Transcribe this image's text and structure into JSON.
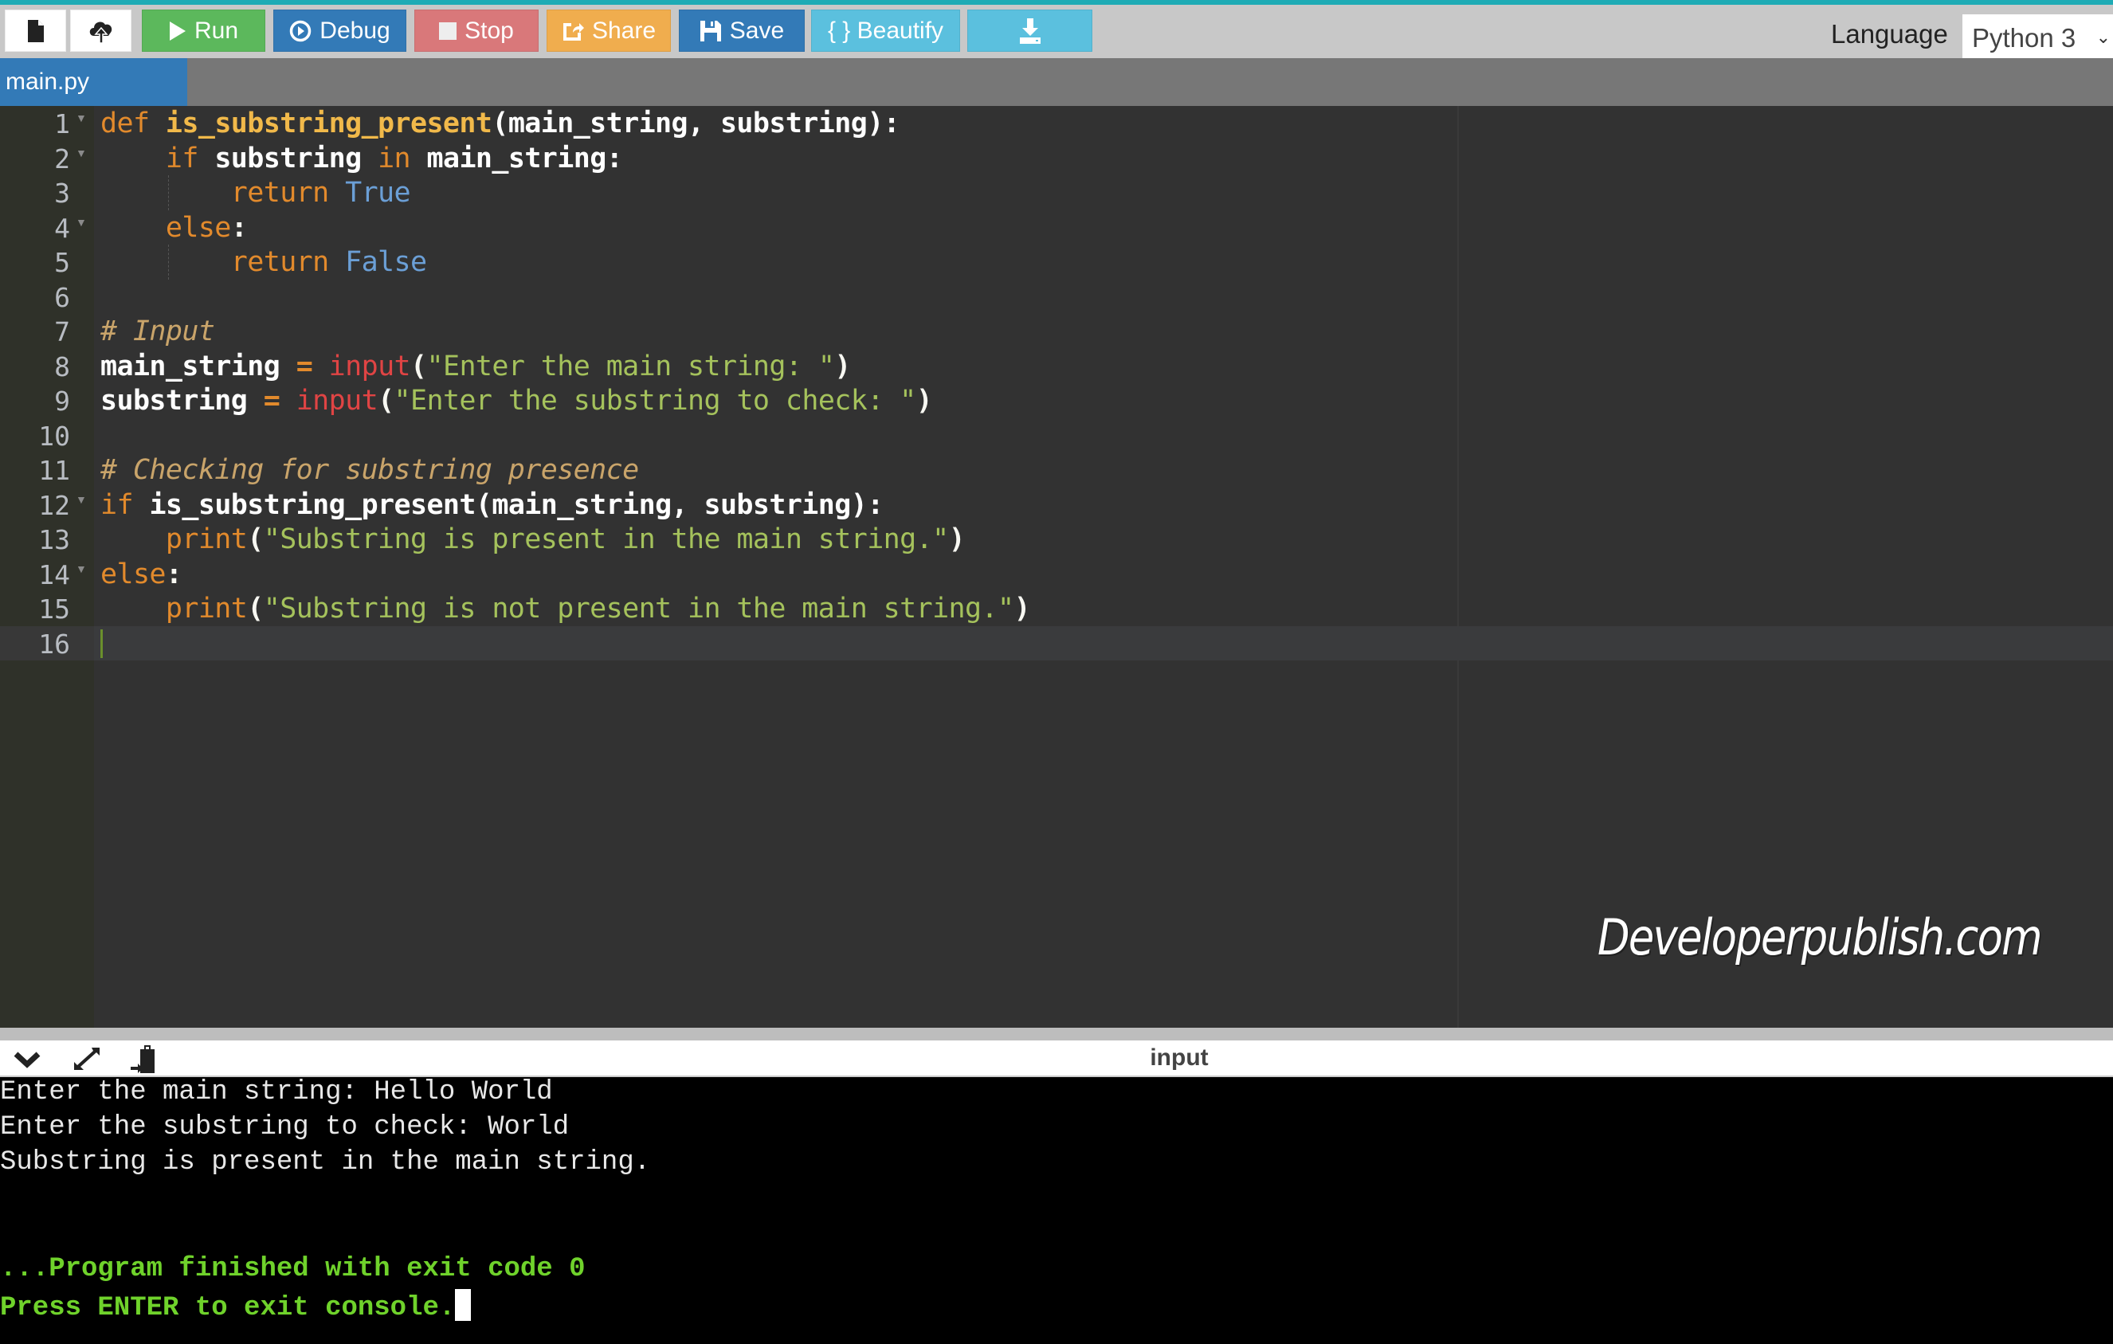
{
  "colors": {
    "accent_topline": "#1eabb5",
    "run": "#5cb85c",
    "debug": "#337ab7",
    "stop": "#d9787a",
    "share": "#f0ad4e",
    "save": "#337ab7",
    "beautify": "#5bc0de",
    "download": "#5bc0de",
    "console_success": "#6fd22b"
  },
  "toolbar": {
    "new_file_icon": "file-icon",
    "upload_icon": "cloud-upload-icon",
    "run_label": "Run",
    "debug_label": "Debug",
    "stop_label": "Stop",
    "share_label": "Share",
    "save_label": "Save",
    "beautify_label": "{ } Beautify",
    "download_icon": "download-icon",
    "language_label": "Language",
    "language_value": "Python 3"
  },
  "tabs": [
    {
      "label": "main.py",
      "active": true
    }
  ],
  "editor": {
    "line_numbers": [
      "1",
      "2",
      "3",
      "4",
      "5",
      "6",
      "7",
      "8",
      "9",
      "10",
      "11",
      "12",
      "13",
      "14",
      "15",
      "16"
    ],
    "active_line": 16,
    "lines": [
      "def is_substring_present(main_string, substring):",
      "    if substring in main_string:",
      "        return True",
      "    else:",
      "        return False",
      "",
      "# Input",
      "main_string = input(\"Enter the main string: \")",
      "substring = input(\"Enter the substring to check: \")",
      "",
      "# Checking for substring presence",
      "if is_substring_present(main_string, substring):",
      "    print(\"Substring is present in the main string.\")",
      "else:",
      "    print(\"Substring is not present in the main string.\")",
      ""
    ],
    "tokens": {
      "l1": {
        "def": "def",
        "fn": "is_substring_present",
        "args": "(main_string, substring):"
      },
      "l2": {
        "if": "if",
        "a": "substring",
        "in": "in",
        "b": "main_string:"
      },
      "l3": {
        "ret": "return",
        "val": "True"
      },
      "l4": {
        "else": "else",
        "colon": ":"
      },
      "l5": {
        "ret": "return",
        "val": "False"
      },
      "l7": {
        "cmt": "# Input"
      },
      "l8": {
        "var": "main_string",
        "eq": "=",
        "fn": "input",
        "open": "(",
        "str": "\"Enter the main string: \"",
        "close": ")"
      },
      "l9": {
        "var": "substring",
        "eq": "=",
        "fn": "input",
        "open": "(",
        "str": "\"Enter the substring to check: \"",
        "close": ")"
      },
      "l11": {
        "cmt": "# Checking for substring presence"
      },
      "l12": {
        "if": "if",
        "rest": "is_substring_present(main_string, substring):"
      },
      "l13": {
        "fn": "print",
        "open": "(",
        "str": "\"Substring is present in the main string.\"",
        "close": ")"
      },
      "l14": {
        "else": "else",
        "colon": ":"
      },
      "l15": {
        "fn": "print",
        "open": "(",
        "str": "\"Substring is not present in the main string.\"",
        "close": ")"
      }
    },
    "fold_lines": [
      1,
      2,
      4,
      12,
      14
    ]
  },
  "watermark": "Developerpublish.com",
  "console": {
    "title": "input",
    "icons": [
      "chevron-down-icon",
      "expand-icon",
      "paste-icon"
    ],
    "output": [
      "Enter the main string: Hello World",
      "Enter the substring to check: World",
      "Substring is present in the main string."
    ],
    "status": [
      "...Program finished with exit code 0",
      "Press ENTER to exit console."
    ]
  }
}
